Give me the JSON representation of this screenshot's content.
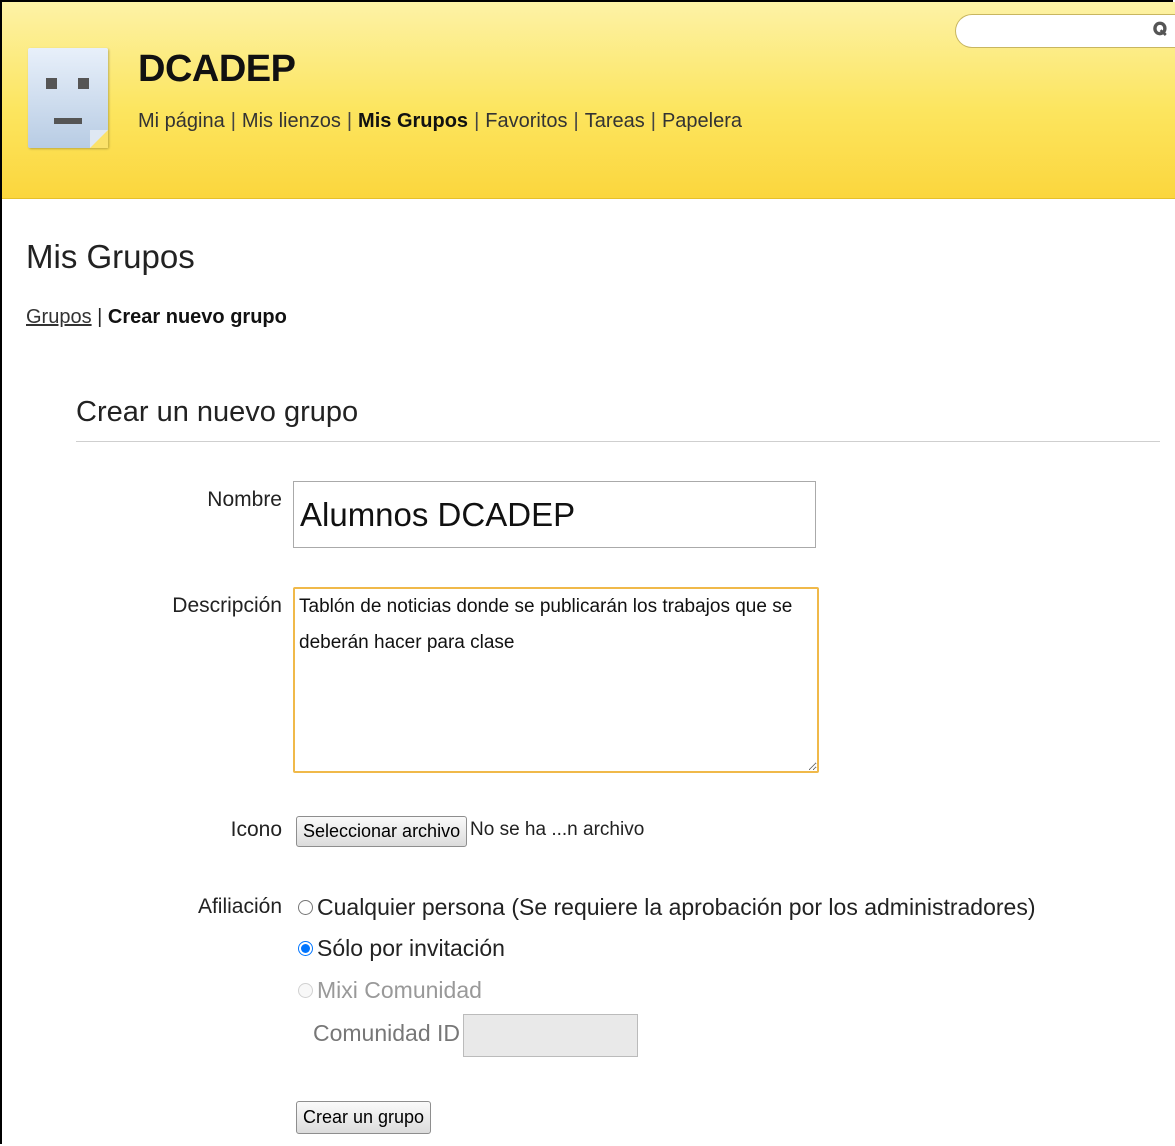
{
  "header": {
    "site_title": "DCADEP",
    "nav": [
      {
        "label": "Mi página",
        "active": false
      },
      {
        "label": "Mis lienzos",
        "active": false
      },
      {
        "label": "Mis Grupos",
        "active": true
      },
      {
        "label": "Favoritos",
        "active": false
      },
      {
        "label": "Tareas",
        "active": false
      },
      {
        "label": "Papelera",
        "active": false
      }
    ],
    "search": {
      "placeholder": "",
      "icon": "search-icon"
    }
  },
  "page_title": "Mis Grupos",
  "breadcrumb": {
    "link": "Grupos",
    "separator": "|",
    "current": "Crear nuevo grupo"
  },
  "form": {
    "section_title": "Crear un nuevo grupo",
    "name_label": "Nombre",
    "name_value": "Alumnos DCADEP",
    "desc_label": "Descripción",
    "desc_value": "Tablón de noticias donde se publicarán los trabajos que se deberán hacer para clase",
    "icon_label": "Icono",
    "file_button": "Seleccionar archivo",
    "file_status": "No se ha ...n archivo",
    "affiliation_label": "Afiliación",
    "affiliation_options": [
      {
        "label": "Cualquier persona (Se requiere la aprobación por los administradores)",
        "checked": false,
        "disabled": false
      },
      {
        "label": "Sólo por invitación",
        "checked": true,
        "disabled": false
      },
      {
        "label": "Mixi Comunidad",
        "checked": false,
        "disabled": true
      }
    ],
    "community_id_label": "Comunidad ID",
    "community_id_value": "",
    "submit_label": "Crear un grupo"
  },
  "colors": {
    "header_yellow": "#fce55f",
    "focus_border": "#f0b94a"
  }
}
